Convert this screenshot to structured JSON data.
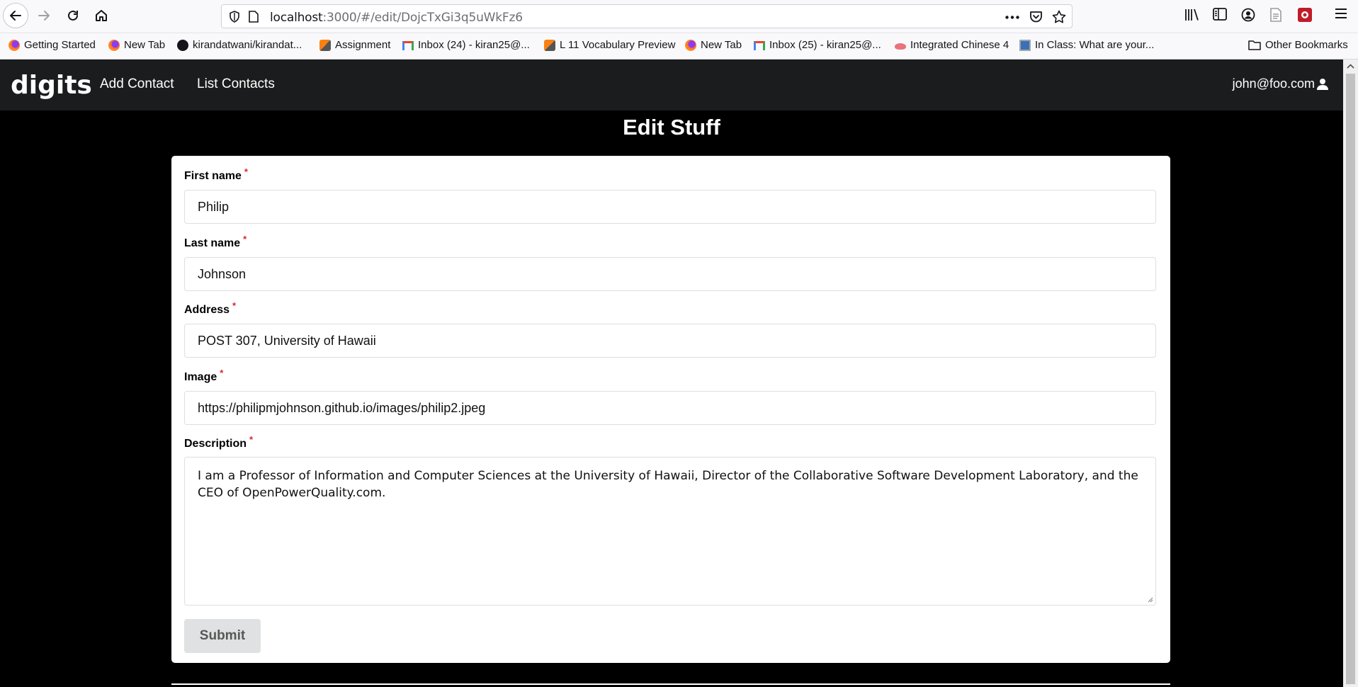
{
  "browser": {
    "url_host": "localhost",
    "url_rest": ":3000/#/edit/DojcTxGi3q5uWkFz6",
    "bookmarks": [
      {
        "label": "Getting Started",
        "icon": "firefox-icon"
      },
      {
        "label": "New Tab",
        "icon": "firefox-icon"
      },
      {
        "label": "kirandatwani/kirandat...",
        "icon": "github-icon"
      },
      {
        "label": "Assignment",
        "icon": "moodle-icon"
      },
      {
        "label": "Inbox (24) - kiran25@...",
        "icon": "gmail-icon"
      },
      {
        "label": "L 11 Vocabulary Preview",
        "icon": "moodle-icon"
      },
      {
        "label": "New Tab",
        "icon": "firefox-icon"
      },
      {
        "label": "Inbox (25) - kiran25@...",
        "icon": "gmail-icon"
      },
      {
        "label": "Integrated Chinese 4",
        "icon": "web-icon"
      },
      {
        "label": "In Class: What are your...",
        "icon": "page-icon"
      }
    ],
    "other_bookmarks": "Other Bookmarks"
  },
  "navbar": {
    "brand": "digits",
    "links": [
      "Add Contact",
      "List Contacts"
    ],
    "user": "john@foo.com"
  },
  "page": {
    "title": "Edit Stuff"
  },
  "form": {
    "first_name": {
      "label": "First name",
      "value": "Philip"
    },
    "last_name": {
      "label": "Last name",
      "value": "Johnson"
    },
    "address": {
      "label": "Address",
      "value": "POST 307, University of Hawaii"
    },
    "image": {
      "label": "Image",
      "value": "https://philipmjohnson.github.io/images/philip2.jpeg"
    },
    "description": {
      "label": "Description",
      "value": "I am a Professor of Information and Computer Sciences at the University of Hawaii, Director of the Collaborative Software Development Laboratory, and the CEO of OpenPowerQuality.com."
    },
    "required_marker": "*",
    "submit_label": "Submit"
  },
  "colors": {
    "navbar_bg": "#1b1c1d",
    "page_bg": "#000000",
    "required": "#db2828",
    "button_bg": "#e0e1e2"
  }
}
